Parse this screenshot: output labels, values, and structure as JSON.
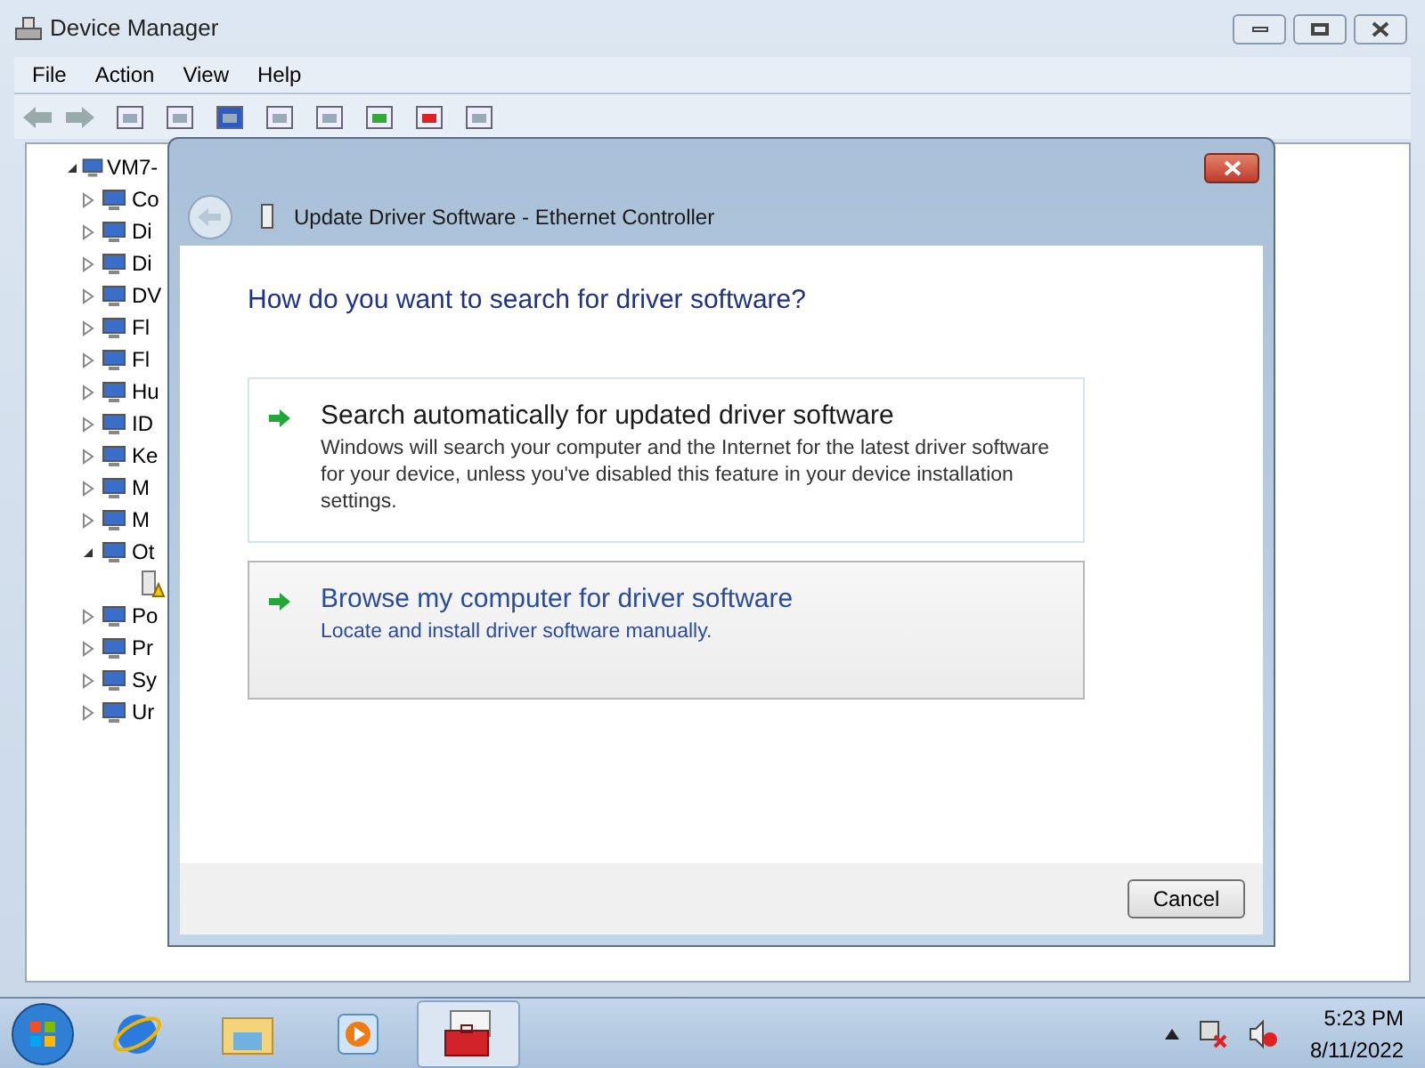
{
  "window": {
    "title": "Device Manager"
  },
  "menu": [
    "File",
    "Action",
    "View",
    "Help"
  ],
  "tree": {
    "label": "VM7-",
    "expanded": true,
    "children": [
      {
        "label": "Co",
        "expanded": false
      },
      {
        "label": "Di",
        "expanded": false
      },
      {
        "label": "Di",
        "expanded": false
      },
      {
        "label": "DV",
        "expanded": false
      },
      {
        "label": "Fl",
        "expanded": false
      },
      {
        "label": "Fl",
        "expanded": false
      },
      {
        "label": "Hu",
        "expanded": false
      },
      {
        "label": "ID",
        "expanded": false
      },
      {
        "label": "Ke",
        "expanded": false
      },
      {
        "label": "M",
        "expanded": false
      },
      {
        "label": "M",
        "expanded": false
      },
      {
        "label": "Ot",
        "expanded": true,
        "children": [
          {
            "kind": "warning-device"
          }
        ]
      },
      {
        "label": "Po",
        "expanded": false
      },
      {
        "label": "Pr",
        "expanded": false
      },
      {
        "label": "Sy",
        "expanded": false
      },
      {
        "label": "Ur",
        "expanded": false
      }
    ]
  },
  "dialog": {
    "title": "Update Driver Software - Ethernet Controller",
    "heading": "How do you want to search for driver software?",
    "options": [
      {
        "title": "Search automatically for updated driver software",
        "description": "Windows will search your computer and the Internet for the latest driver software for your device, unless you've disabled this feature in your device installation settings.",
        "hovered": false
      },
      {
        "title": "Browse my computer for driver software",
        "description": "Locate and install driver software manually.",
        "hovered": true
      }
    ],
    "buttons": [
      "Cancel"
    ]
  },
  "taskbar": {
    "apps": [
      {
        "kind": "ie",
        "selected": false
      },
      {
        "kind": "explorer",
        "selected": false
      },
      {
        "kind": "media",
        "selected": false
      },
      {
        "kind": "devmgr",
        "selected": true
      }
    ],
    "time": "5:23 PM",
    "date": "8/11/2022"
  }
}
